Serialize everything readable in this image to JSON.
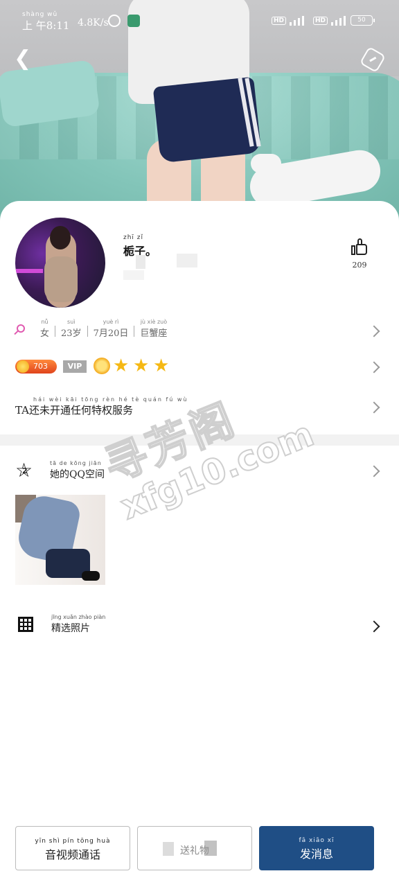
{
  "status_bar": {
    "time_ruby": "shàng wǔ",
    "time": "上 午8:11",
    "net_speed": "4.8K/s",
    "hd1": "HD",
    "hd2": "HD",
    "battery": "50"
  },
  "profile": {
    "name_pinyin": "zhī zǐ",
    "name": "栀子。",
    "likes": "209",
    "info": [
      {
        "pinyin": "nǚ",
        "text": "女"
      },
      {
        "pinyin": "suì",
        "text": "23岁"
      },
      {
        "pinyin": "yuè rì",
        "text": "7月20日"
      },
      {
        "pinyin": "jù xiè zuò",
        "text": "巨蟹座"
      }
    ],
    "coins": "703",
    "vip": "VIP",
    "privilege_pinyin": "hái wèi kāi tōng rèn hé tè quán fú wù",
    "privilege_text": "TA还未开通任何特权服务"
  },
  "qzone": {
    "badge": "2",
    "pinyin": "tā de kōng jiān",
    "label": "她的QQ空间"
  },
  "featured": {
    "pinyin": "jīng xuǎn zhào piàn",
    "label": "精选照片"
  },
  "watermark": {
    "line1": "寻芳阁",
    "line2": "xfg10.com"
  },
  "buttons": {
    "call_pinyin": "yīn shì pín tōng huà",
    "call_label": "音视频通话",
    "mid_label": "送礼物",
    "msg_pinyin": "fā xiāo xī",
    "msg_label": "发消息"
  },
  "colors": {
    "accent": "#1f4e85",
    "star": "#f5b814",
    "coin": "#e0441c"
  }
}
